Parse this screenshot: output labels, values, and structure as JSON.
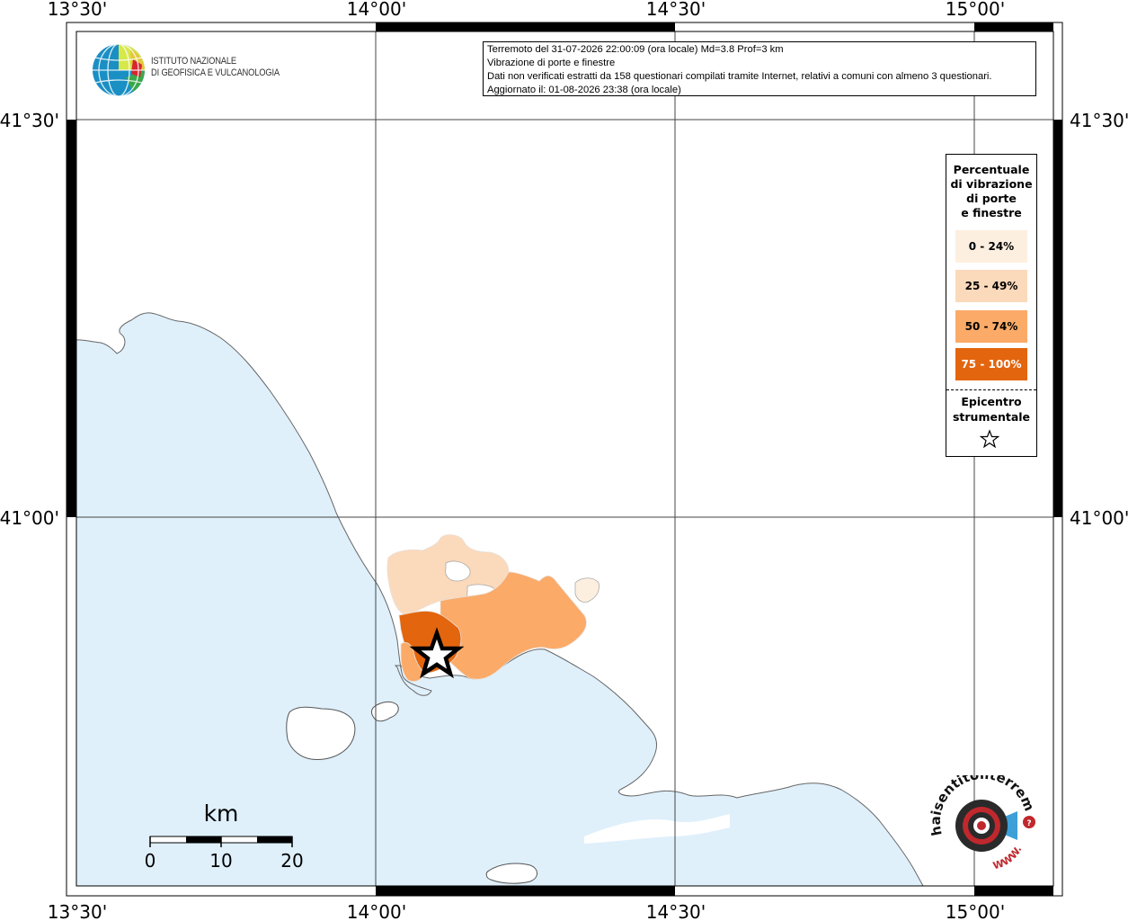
{
  "map": {
    "top_coords": [
      "13°30'",
      "14°00'",
      "14°30'",
      "15°00'"
    ],
    "bottom_coords": [
      "13°30'",
      "14°00'",
      "14°30'",
      "15°00'"
    ],
    "left_coords": [
      "41°30'",
      "41°00'"
    ],
    "right_coords": [
      "41°30'",
      "41°00'"
    ],
    "sea_color": "#dff0fb"
  },
  "info": {
    "line1": "Terremoto del 31-07-2026 22:00:09 (ora locale) Md=3.8 Prof=3 km",
    "line2": "Vibrazione di porte e finestre",
    "line3": "Dati non verificati estratti da 158 questionari compilati tramite Internet, relativi a comuni con almeno 3 questionari.",
    "line4": "Aggiornato il: 01-08-2026 23:38 (ora locale)"
  },
  "legend": {
    "title": [
      "Percentuale",
      "di vibrazione",
      "di porte",
      "e finestre"
    ],
    "items": [
      {
        "label": "0 - 24%",
        "color": "#fdefdf",
        "text_color": "#000000"
      },
      {
        "label": "25 - 49%",
        "color": "#fbd9bb",
        "text_color": "#000000"
      },
      {
        "label": "50 - 74%",
        "color": "#fbaa68",
        "text_color": "#000000"
      },
      {
        "label": "75 - 100%",
        "color": "#e3650d",
        "text_color": "#ffffff"
      }
    ],
    "epicentre": [
      "Epicentro",
      "strumentale"
    ]
  },
  "scale_bar": {
    "unit": "km",
    "ticks": [
      "0",
      "10",
      "20"
    ]
  },
  "ingv": {
    "line1": "ISTITUTO NAZIONALE",
    "line2": "DI GEOFISICA E VULCANOLOGIA"
  },
  "hst": {
    "text": "haisentitoilterremoto.it",
    "www": "WWW."
  }
}
